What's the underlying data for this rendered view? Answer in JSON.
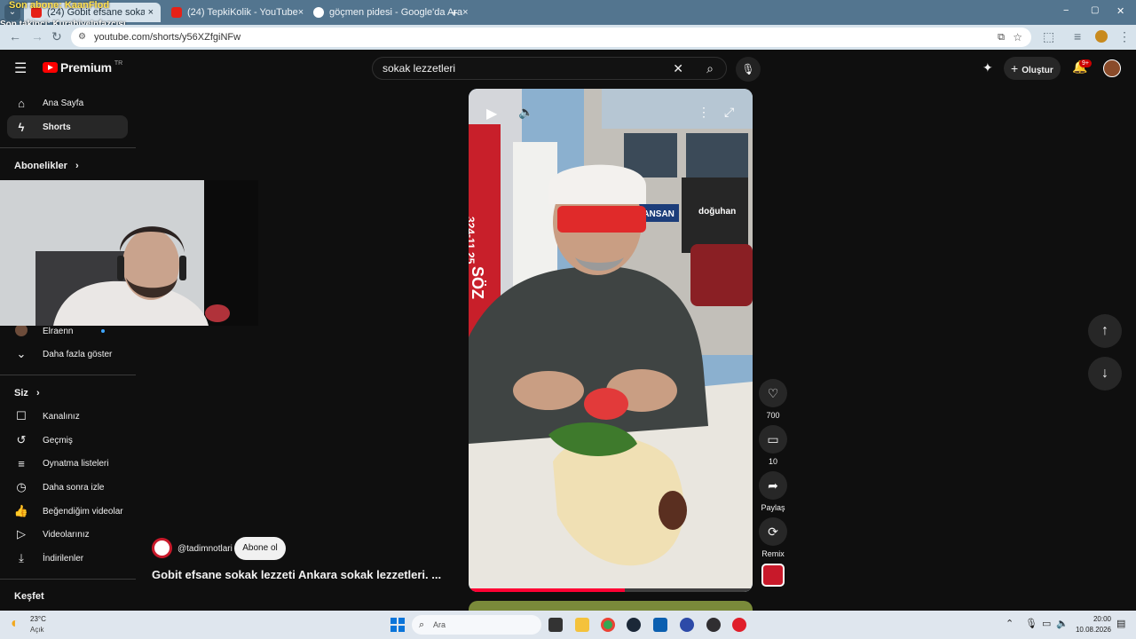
{
  "overlay": {
    "line1": "Son abone: KaanFlod",
    "line2": "Son takipçi: KurabiyeInfazcısı"
  },
  "tabs": [
    {
      "title": "(24) Gobit efsane sokak lezzeti",
      "close": "×",
      "favicon": "youtube",
      "active": true
    },
    {
      "title": "(24) TepkiKolik - YouTube",
      "close": "×",
      "favicon": "youtube",
      "active": false
    },
    {
      "title": "göçmen pidesi - Google'da Ara",
      "close": "×",
      "favicon": "google",
      "active": false
    }
  ],
  "new_tab": "+",
  "window_controls": {
    "minimize": "−",
    "maximize": "▢",
    "close": "✕"
  },
  "address": {
    "url": "youtube.com/shorts/y56XZfgiNFw"
  },
  "header": {
    "logo_text": "Premium",
    "logo_badge": "TR",
    "search_value": "sokak lezzetleri",
    "create_label": "Oluştur",
    "notif_badge": "9+"
  },
  "sidebar": {
    "top_items": [
      {
        "label": "Ana Sayfa",
        "icon": "home-icon"
      },
      {
        "label": "Shorts",
        "icon": "shorts-icon"
      }
    ],
    "subs_heading": "Abonelikler",
    "subs_item": "Elraenn",
    "show_more": "Daha fazla göster",
    "you_heading": "Siz",
    "you_items": [
      {
        "label": "Kanalınız",
        "icon": "channel-icon"
      },
      {
        "label": "Geçmiş",
        "icon": "history-icon"
      },
      {
        "label": "Oynatma listeleri",
        "icon": "playlist-icon"
      },
      {
        "label": "Daha sonra izle",
        "icon": "clock-icon"
      },
      {
        "label": "Beğendiğim videolar",
        "icon": "like-icon"
      },
      {
        "label": "Videolarınız",
        "icon": "video-icon"
      },
      {
        "label": "İndirilenler",
        "icon": "download-icon"
      }
    ],
    "explore_heading": "Keşfet"
  },
  "video": {
    "channel": "@tadimnotlari",
    "subscribe": "Abone ol",
    "title": "Gobit efsane sokak lezzeti Ankara sokak lezzetleri. ...",
    "progress": 0.55,
    "likes": "700",
    "comments": "10",
    "share": "Paylaş",
    "remix": "Remix"
  },
  "video_scene": {
    "sign_code": "324-11 25",
    "sign_left": "SÖZ",
    "sign_mansan": "MANSAN",
    "banner": "doğuhan"
  },
  "taskbar": {
    "temp": "23°C",
    "weather": "Açık",
    "search": "Ara",
    "time": "20:00",
    "date": "10.08.2026"
  }
}
